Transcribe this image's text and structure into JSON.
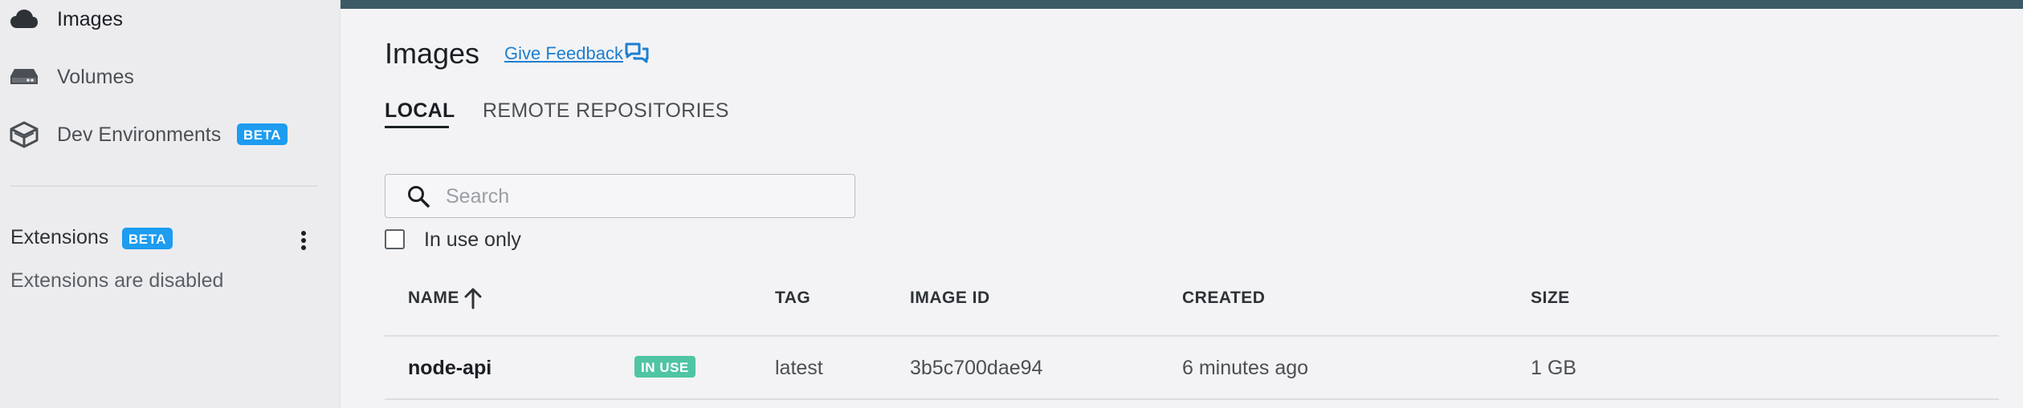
{
  "sidebar": {
    "items": [
      {
        "label": "Images",
        "icon": "cloud-icon",
        "active": true
      },
      {
        "label": "Volumes",
        "icon": "drive-icon",
        "active": false
      },
      {
        "label": "Dev Environments",
        "icon": "cube-icon",
        "badge": "BETA",
        "active": false
      }
    ],
    "extensions": {
      "title": "Extensions",
      "badge": "BETA",
      "status": "Extensions are disabled"
    }
  },
  "header": {
    "accent": "#3c5a66",
    "title": "Images",
    "feedback_label": "Give Feedback"
  },
  "tabs": [
    {
      "label": "LOCAL",
      "active": true
    },
    {
      "label": "REMOTE REPOSITORIES",
      "active": false
    }
  ],
  "search": {
    "placeholder": "Search",
    "value": ""
  },
  "filter": {
    "in_use_only_label": "In use only",
    "checked": false
  },
  "table": {
    "columns": {
      "name": "NAME",
      "tag": "TAG",
      "image_id": "IMAGE ID",
      "created": "CREATED",
      "size": "SIZE"
    },
    "sort": {
      "column": "name",
      "direction": "ascending"
    },
    "rows": [
      {
        "name": "node-api",
        "status_badge": "IN USE",
        "tag": "latest",
        "image_id": "3b5c700dae94",
        "created": "6 minutes ago",
        "size": "1 GB"
      }
    ]
  },
  "colors": {
    "beta_badge": "#1d9cf0",
    "in_use_badge": "#4fc5a3",
    "link": "#1d7fd1"
  }
}
